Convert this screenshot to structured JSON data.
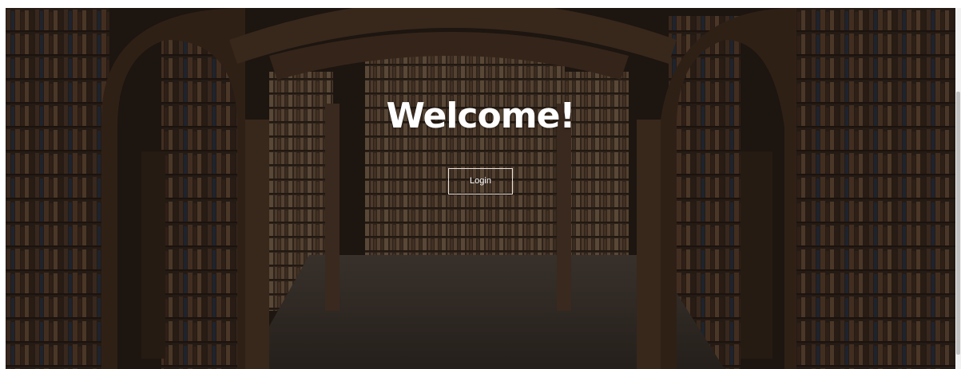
{
  "hero": {
    "title": "Welcome!",
    "background_image": "library-arches-bookshelves",
    "overlay_color": "#0a0806"
  },
  "actions": {
    "login_label": "Login"
  },
  "colors": {
    "title": "#ffffff",
    "button_border": "#e8e2da",
    "button_text": "#ffffff"
  }
}
